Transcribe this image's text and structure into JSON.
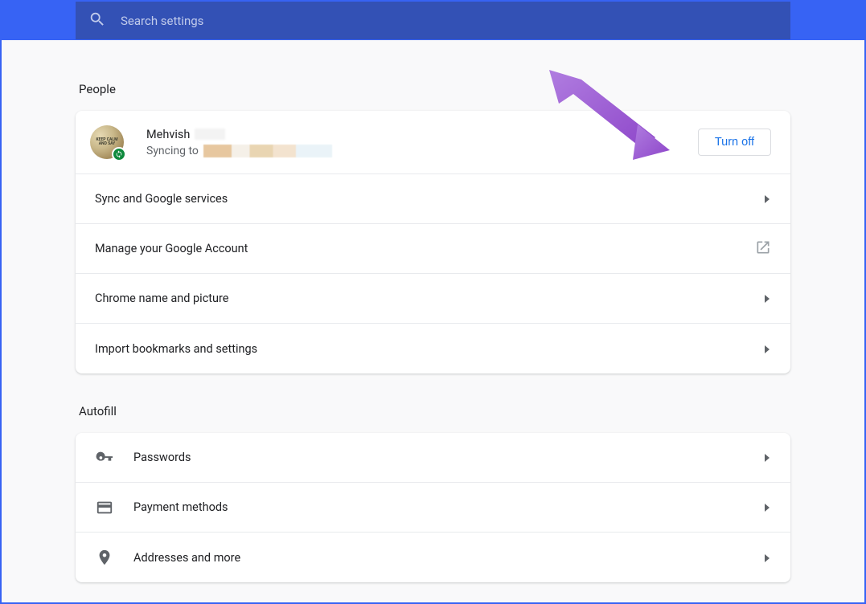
{
  "search": {
    "placeholder": "Search settings"
  },
  "sections": {
    "people": {
      "title": "People",
      "profile": {
        "name": "Mehvish",
        "sync_prefix": "Syncing to",
        "button_label": "Turn off"
      },
      "rows": [
        {
          "label": "Sync and Google services",
          "trailing": "chevron"
        },
        {
          "label": "Manage your Google Account",
          "trailing": "external"
        },
        {
          "label": "Chrome name and picture",
          "trailing": "chevron"
        },
        {
          "label": "Import bookmarks and settings",
          "trailing": "chevron"
        }
      ]
    },
    "autofill": {
      "title": "Autofill",
      "rows": [
        {
          "label": "Passwords",
          "icon": "key"
        },
        {
          "label": "Payment methods",
          "icon": "card"
        },
        {
          "label": "Addresses and more",
          "icon": "location"
        }
      ]
    }
  },
  "colors": {
    "banner": "#3763f4",
    "searchbar": "#3351b5",
    "link": "#1a73e8",
    "sync_badge": "#0f8a3d",
    "arrow": "#9b59d0"
  }
}
